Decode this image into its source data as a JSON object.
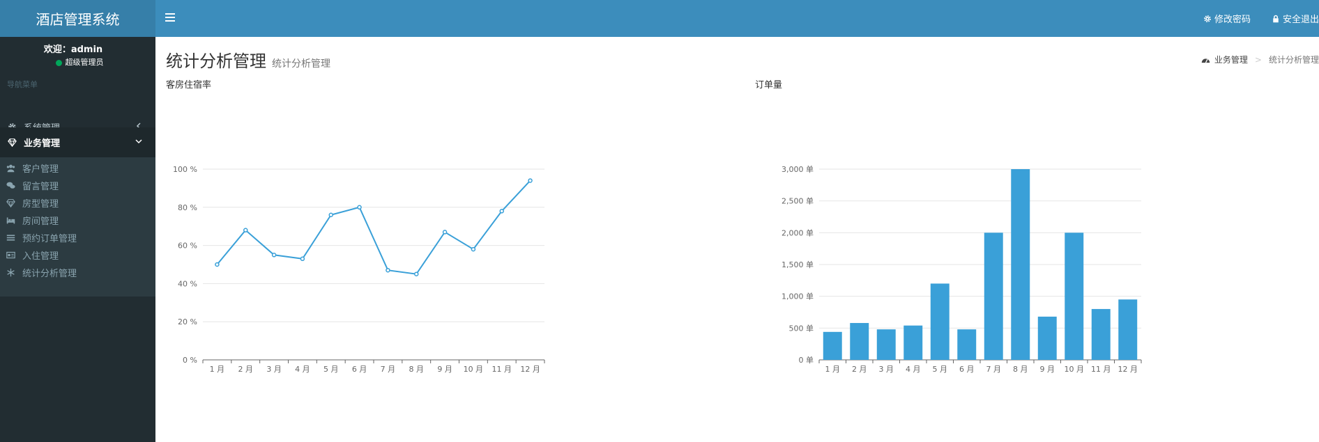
{
  "app": {
    "title": "酒店管理系统"
  },
  "header": {
    "change_password": "修改密码",
    "logout": "安全退出"
  },
  "user": {
    "welcome": "欢迎：admin",
    "role": "超级管理员"
  },
  "sidebar": {
    "nav_header": "导航菜单",
    "items": [
      {
        "label": "系统管理",
        "icon": "gear-icon"
      },
      {
        "label": "业务管理",
        "icon": "diamond-icon"
      }
    ],
    "sub_items": [
      {
        "label": "客户管理",
        "icon": "users-icon"
      },
      {
        "label": "留言管理",
        "icon": "comments-icon"
      },
      {
        "label": "房型管理",
        "icon": "diamond-icon"
      },
      {
        "label": "房间管理",
        "icon": "bed-icon"
      },
      {
        "label": "预约订单管理",
        "icon": "list-icon"
      },
      {
        "label": "入住管理",
        "icon": "id-card-icon"
      },
      {
        "label": "统计分析管理",
        "icon": "snowflake-icon"
      }
    ]
  },
  "page": {
    "title": "统计分析管理",
    "subtitle": "统计分析管理"
  },
  "breadcrumb": {
    "home": "业务管理",
    "current": "统计分析管理"
  },
  "colors": {
    "accent": "#3c8dbc",
    "series": "#3aa0d8",
    "sidebar": "#222d32"
  },
  "chart_data": [
    {
      "type": "line",
      "title": "客房住宿率",
      "categories": [
        "1 月",
        "2 月",
        "3 月",
        "4 月",
        "5 月",
        "6 月",
        "7 月",
        "8 月",
        "9 月",
        "10 月",
        "11 月",
        "12 月"
      ],
      "values": [
        50,
        68,
        55,
        53,
        76,
        80,
        47,
        45,
        67,
        58,
        78,
        94
      ],
      "ylim": [
        0,
        100
      ],
      "yticks": [
        "0 %",
        "20 %",
        "40 %",
        "60 %",
        "80 %",
        "100 %"
      ],
      "grid": true
    },
    {
      "type": "bar",
      "title": "订单量",
      "categories": [
        "1 月",
        "2 月",
        "3 月",
        "4 月",
        "5 月",
        "6 月",
        "7 月",
        "8 月",
        "9 月",
        "10 月",
        "11 月",
        "12 月"
      ],
      "values": [
        440,
        580,
        480,
        540,
        1200,
        480,
        2000,
        3000,
        680,
        2000,
        800,
        950
      ],
      "ylim": [
        0,
        3000
      ],
      "yticks": [
        "0 单",
        "500 单",
        "1,000 单",
        "1,500 单",
        "2,000 单",
        "2,500 单",
        "3,000 单"
      ],
      "grid": true
    }
  ]
}
